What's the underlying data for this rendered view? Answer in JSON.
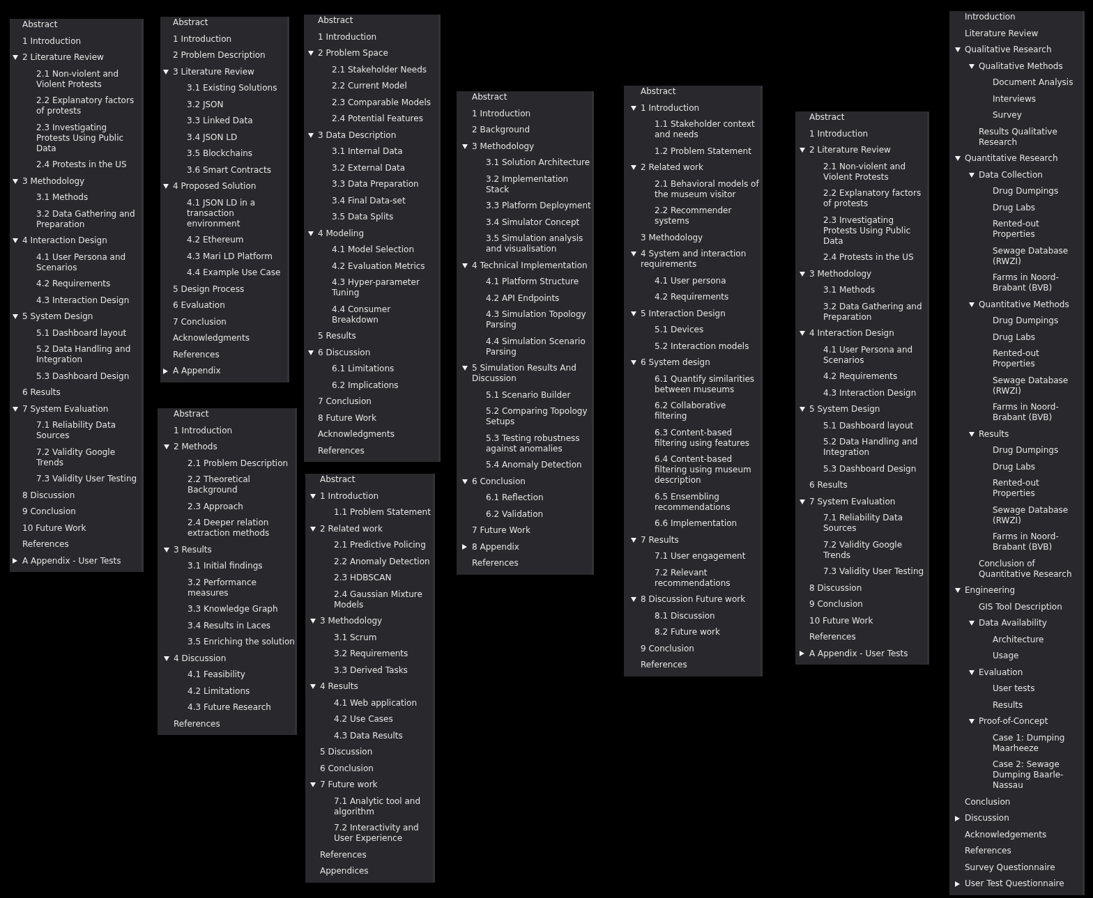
{
  "panels": [
    {
      "items": [
        {
          "label": "Abstract"
        },
        {
          "label": "1 Introduction"
        },
        {
          "label": "2 Literature Review",
          "expanded": true,
          "children": [
            {
              "label": "2.1 Non-violent and Violent Protests"
            },
            {
              "label": "2.2 Explanatory factors of protests"
            },
            {
              "label": "2.3 Investigating Protests Using Public Data"
            },
            {
              "label": "2.4 Protests in the US"
            }
          ]
        },
        {
          "label": "3 Methodology",
          "expanded": true,
          "children": [
            {
              "label": "3.1 Methods"
            },
            {
              "label": "3.2 Data Gathering and Preparation"
            }
          ]
        },
        {
          "label": "4 Interaction Design",
          "expanded": true,
          "children": [
            {
              "label": "4.1 User Persona and Scenarios"
            },
            {
              "label": "4.2 Requirements"
            },
            {
              "label": "4.3 Interaction Design"
            }
          ]
        },
        {
          "label": "5 System Design",
          "expanded": true,
          "children": [
            {
              "label": "5.1 Dashboard layout"
            },
            {
              "label": "5.2 Data Handling and Integration"
            },
            {
              "label": "5.3 Dashboard Design"
            }
          ]
        },
        {
          "label": "6 Results"
        },
        {
          "label": "7 System Evaluation",
          "expanded": true,
          "children": [
            {
              "label": "7.1 Reliability Data Sources"
            },
            {
              "label": "7.2 Validity Google Trends"
            },
            {
              "label": "7.3 Validity User Testing"
            }
          ]
        },
        {
          "label": "8 Discussion"
        },
        {
          "label": "9 Conclusion"
        },
        {
          "label": "10 Future Work"
        },
        {
          "label": "References"
        },
        {
          "label": "A Appendix - User Tests",
          "expanded": false
        }
      ]
    },
    {
      "items": [
        {
          "label": "Abstract"
        },
        {
          "label": "1 Introduction"
        },
        {
          "label": "2 Problem Description"
        },
        {
          "label": "3 Literature Review",
          "expanded": true,
          "children": [
            {
              "label": "3.1 Existing Solutions"
            },
            {
              "label": "3.2 JSON"
            },
            {
              "label": "3.3 Linked Data"
            },
            {
              "label": "3.4 JSON LD"
            },
            {
              "label": "3.5 Blockchains"
            },
            {
              "label": "3.6 Smart Contracts"
            }
          ]
        },
        {
          "label": "4 Proposed Solution",
          "expanded": true,
          "children": [
            {
              "label": "4.1 JSON LD in a transaction environment"
            },
            {
              "label": "4.2 Ethereum"
            },
            {
              "label": "4.3 Mari LD Platform"
            },
            {
              "label": "4.4 Example Use Case"
            }
          ]
        },
        {
          "label": "5 Design Process"
        },
        {
          "label": "6 Evaluation"
        },
        {
          "label": "7 Conclusion"
        },
        {
          "label": "Acknowledgments"
        },
        {
          "label": "References"
        },
        {
          "label": "A Appendix",
          "expanded": false
        }
      ]
    },
    {
      "items": [
        {
          "label": "Abstract"
        },
        {
          "label": "1 Introduction"
        },
        {
          "label": "2 Methods",
          "expanded": true,
          "children": [
            {
              "label": "2.1 Problem Description"
            },
            {
              "label": "2.2 Theoretical Background"
            },
            {
              "label": "2.3 Approach"
            },
            {
              "label": "2.4 Deeper relation extraction methods"
            }
          ]
        },
        {
          "label": "3 Results",
          "expanded": true,
          "children": [
            {
              "label": "3.1 Initial findings"
            },
            {
              "label": "3.2 Performance measures"
            },
            {
              "label": "3.3 Knowledge Graph"
            },
            {
              "label": "3.4 Results in Laces"
            },
            {
              "label": "3.5 Enriching the solution"
            }
          ]
        },
        {
          "label": "4 Discussion",
          "expanded": true,
          "children": [
            {
              "label": "4.1 Feasibility"
            },
            {
              "label": "4.2 Limitations"
            },
            {
              "label": "4.3 Future Research"
            }
          ]
        },
        {
          "label": "References"
        }
      ]
    },
    {
      "items": [
        {
          "label": "Abstract"
        },
        {
          "label": "1 Introduction"
        },
        {
          "label": "2 Problem Space",
          "expanded": true,
          "children": [
            {
              "label": "2.1 Stakeholder Needs"
            },
            {
              "label": "2.2 Current Model"
            },
            {
              "label": "2.3 Comparable Models"
            },
            {
              "label": "2.4 Potential Features"
            }
          ]
        },
        {
          "label": "3 Data Description",
          "expanded": true,
          "children": [
            {
              "label": "3.1 Internal Data"
            },
            {
              "label": "3.2 External Data"
            },
            {
              "label": "3.3 Data Preparation"
            },
            {
              "label": "3.4 Final Data-set"
            },
            {
              "label": "3.5 Data Splits"
            }
          ]
        },
        {
          "label": "4 Modeling",
          "expanded": true,
          "children": [
            {
              "label": "4.1 Model Selection"
            },
            {
              "label": "4.2 Evaluation Metrics"
            },
            {
              "label": "4.3 Hyper-parameter Tuning"
            },
            {
              "label": "4.4 Consumer Breakdown"
            }
          ]
        },
        {
          "label": "5 Results"
        },
        {
          "label": "6 Discussion",
          "expanded": true,
          "children": [
            {
              "label": "6.1 Limitations"
            },
            {
              "label": "6.2 Implications"
            }
          ]
        },
        {
          "label": "7 Conclusion"
        },
        {
          "label": "8 Future Work"
        },
        {
          "label": "Acknowledgments"
        },
        {
          "label": "References"
        }
      ]
    },
    {
      "items": [
        {
          "label": "Abstract"
        },
        {
          "label": "1 Introduction",
          "expanded": true,
          "children": [
            {
              "label": "1.1 Problem Statement"
            }
          ]
        },
        {
          "label": "2 Related work",
          "expanded": true,
          "children": [
            {
              "label": "2.1 Predictive Policing"
            },
            {
              "label": "2.2 Anomaly Detection"
            },
            {
              "label": "2.3 HDBSCAN"
            },
            {
              "label": "2.4 Gaussian Mixture Models"
            }
          ]
        },
        {
          "label": "3 Methodology",
          "expanded": true,
          "children": [
            {
              "label": "3.1 Scrum"
            },
            {
              "label": "3.2 Requirements"
            },
            {
              "label": "3.3 Derived Tasks"
            }
          ]
        },
        {
          "label": "4 Results",
          "expanded": true,
          "children": [
            {
              "label": "4.1 Web application"
            },
            {
              "label": "4.2 Use Cases"
            },
            {
              "label": "4.3 Data Results"
            }
          ]
        },
        {
          "label": "5 Discussion"
        },
        {
          "label": "6 Conclusion"
        },
        {
          "label": "7 Future work",
          "expanded": true,
          "children": [
            {
              "label": "7.1 Analytic tool and algorithm"
            },
            {
              "label": "7.2 Interactivity and User Experience"
            }
          ]
        },
        {
          "label": "References"
        },
        {
          "label": "Appendices"
        }
      ]
    },
    {
      "items": [
        {
          "label": "Abstract"
        },
        {
          "label": "1 Introduction"
        },
        {
          "label": "2 Background"
        },
        {
          "label": "3 Methodology",
          "expanded": true,
          "children": [
            {
              "label": "3.1 Solution Architecture"
            },
            {
              "label": "3.2 Implementation Stack"
            },
            {
              "label": "3.3 Platform Deployment"
            },
            {
              "label": "3.4 Simulator Concept"
            },
            {
              "label": "3.5 Simulation analysis and visualisation"
            }
          ]
        },
        {
          "label": "4 Technical Implementation",
          "expanded": true,
          "children": [
            {
              "label": "4.1 Platform Structure"
            },
            {
              "label": "4.2 API Endpoints"
            },
            {
              "label": "4.3 Simulation Topology Parsing"
            },
            {
              "label": "4.4 Simulation Scenario Parsing"
            }
          ]
        },
        {
          "label": "5 Simulation Results And Discussion",
          "expanded": true,
          "children": [
            {
              "label": "5.1 Scenario Builder"
            },
            {
              "label": "5.2 Comparing Topology Setups"
            },
            {
              "label": "5.3 Testing robustness against anomalies"
            },
            {
              "label": "5.4 Anomaly Detection"
            }
          ]
        },
        {
          "label": "6 Conclusion",
          "expanded": true,
          "children": [
            {
              "label": "6.1 Reflection"
            },
            {
              "label": "6.2 Validation"
            }
          ]
        },
        {
          "label": "7 Future Work"
        },
        {
          "label": "8 Appendix",
          "expanded": false
        },
        {
          "label": "References"
        }
      ]
    },
    {
      "items": [
        {
          "label": "Abstract"
        },
        {
          "label": "1 Introduction",
          "expanded": true,
          "children": [
            {
              "label": "1.1 Stakeholder context and needs"
            },
            {
              "label": "1.2 Problem Statement"
            }
          ]
        },
        {
          "label": "2 Related work",
          "expanded": true,
          "children": [
            {
              "label": "2.1 Behavioral models of the museum visitor"
            },
            {
              "label": "2.2 Recommender systems"
            }
          ]
        },
        {
          "label": "3 Methodology"
        },
        {
          "label": "4 System and interaction requirements",
          "expanded": true,
          "children": [
            {
              "label": "4.1 User persona"
            },
            {
              "label": "4.2 Requirements"
            }
          ]
        },
        {
          "label": "5 Interaction Design",
          "expanded": true,
          "children": [
            {
              "label": "5.1 Devices"
            },
            {
              "label": "5.2 Interaction models"
            }
          ]
        },
        {
          "label": "6 System design",
          "expanded": true,
          "children": [
            {
              "label": "6.1 Quantify similarities between museums"
            },
            {
              "label": "6.2 Collaborative filtering"
            },
            {
              "label": "6.3 Content-based filtering using features"
            },
            {
              "label": "6.4 Content-based filtering using museum description"
            },
            {
              "label": "6.5 Ensembling recommendations"
            },
            {
              "label": "6.6 Implementation"
            }
          ]
        },
        {
          "label": "7 Results",
          "expanded": true,
          "children": [
            {
              "label": "7.1 User engagement"
            },
            {
              "label": "7.2 Relevant recommendations"
            }
          ]
        },
        {
          "label": "8 Discussion Future work",
          "expanded": true,
          "children": [
            {
              "label": "8.1 Discussion"
            },
            {
              "label": "8.2 Future work"
            }
          ]
        },
        {
          "label": "9 Conclusion"
        },
        {
          "label": "References"
        }
      ]
    },
    {
      "items": [
        {
          "label": "Abstract"
        },
        {
          "label": "1 Introduction"
        },
        {
          "label": "2 Literature Review",
          "expanded": true,
          "children": [
            {
              "label": "2.1 Non-violent and Violent Protests"
            },
            {
              "label": "2.2 Explanatory factors of protests"
            },
            {
              "label": "2.3 Investigating Protests Using Public Data"
            },
            {
              "label": "2.4 Protests in the US"
            }
          ]
        },
        {
          "label": "3 Methodology",
          "expanded": true,
          "children": [
            {
              "label": "3.1 Methods"
            },
            {
              "label": "3.2 Data Gathering and Preparation"
            }
          ]
        },
        {
          "label": "4 Interaction Design",
          "expanded": true,
          "children": [
            {
              "label": "4.1 User Persona and Scenarios"
            },
            {
              "label": "4.2 Requirements"
            },
            {
              "label": "4.3 Interaction Design"
            }
          ]
        },
        {
          "label": "5 System Design",
          "expanded": true,
          "children": [
            {
              "label": "5.1 Dashboard layout"
            },
            {
              "label": "5.2 Data Handling and Integration"
            },
            {
              "label": "5.3 Dashboard Design"
            }
          ]
        },
        {
          "label": "6 Results"
        },
        {
          "label": "7 System Evaluation",
          "expanded": true,
          "children": [
            {
              "label": "7.1 Reliability Data Sources"
            },
            {
              "label": "7.2 Validity Google Trends"
            },
            {
              "label": "7.3 Validity User Testing"
            }
          ]
        },
        {
          "label": "8 Discussion"
        },
        {
          "label": "9 Conclusion"
        },
        {
          "label": "10 Future Work"
        },
        {
          "label": "References"
        },
        {
          "label": "A Appendix - User Tests",
          "expanded": false
        }
      ]
    },
    {
      "items": [
        {
          "label": "Introduction"
        },
        {
          "label": "Literature Review"
        },
        {
          "label": "Qualitative Research",
          "expanded": true,
          "children": [
            {
              "label": "Qualitative Methods",
              "expanded": true,
              "children": [
                {
                  "label": "Document Analysis"
                },
                {
                  "label": "Interviews"
                },
                {
                  "label": "Survey"
                }
              ]
            },
            {
              "label": "Results Qualitative Research"
            }
          ]
        },
        {
          "label": "Quantitative Research",
          "expanded": true,
          "children": [
            {
              "label": "Data Collection",
              "expanded": true,
              "children": [
                {
                  "label": "Drug Dumpings"
                },
                {
                  "label": "Drug Labs"
                },
                {
                  "label": "Rented-out Properties"
                },
                {
                  "label": "Sewage Database (RWZI)"
                },
                {
                  "label": "Farms in Noord-Brabant (BVB)"
                }
              ]
            },
            {
              "label": "Quantitative Methods",
              "expanded": true,
              "children": [
                {
                  "label": "Drug Dumpings"
                },
                {
                  "label": "Drug Labs"
                },
                {
                  "label": "Rented-out Properties"
                },
                {
                  "label": "Sewage Database (RWZI)"
                },
                {
                  "label": "Farms in Noord-Brabant (BVB)"
                }
              ]
            },
            {
              "label": "Results",
              "expanded": true,
              "children": [
                {
                  "label": "Drug Dumpings"
                },
                {
                  "label": "Drug Labs"
                },
                {
                  "label": "Rented-out Properties"
                },
                {
                  "label": "Sewage Database (RWZI)"
                },
                {
                  "label": "Farms in Noord-Brabant (BVB)"
                }
              ]
            },
            {
              "label": "Conclusion of Quantitative Research"
            }
          ]
        },
        {
          "label": "Engineering",
          "expanded": true,
          "children": [
            {
              "label": "GIS Tool Description"
            },
            {
              "label": "Data Availability",
              "expanded": true,
              "children": [
                {
                  "label": "Architecture"
                },
                {
                  "label": "Usage"
                }
              ]
            },
            {
              "label": "Evaluation",
              "expanded": true,
              "children": [
                {
                  "label": "User tests"
                },
                {
                  "label": "Results"
                }
              ]
            },
            {
              "label": "Proof-of-Concept",
              "expanded": true,
              "children": [
                {
                  "label": "Case 1: Dumping Maarheeze"
                },
                {
                  "label": "Case 2: Sewage Dumping Baarle-Nassau"
                }
              ]
            }
          ]
        },
        {
          "label": "Conclusion"
        },
        {
          "label": "Discussion",
          "expanded": false
        },
        {
          "label": "Acknowledgements"
        },
        {
          "label": "References"
        },
        {
          "label": "Survey Questionnaire"
        },
        {
          "label": "User Test Questionnaire",
          "expanded": false
        }
      ]
    }
  ]
}
